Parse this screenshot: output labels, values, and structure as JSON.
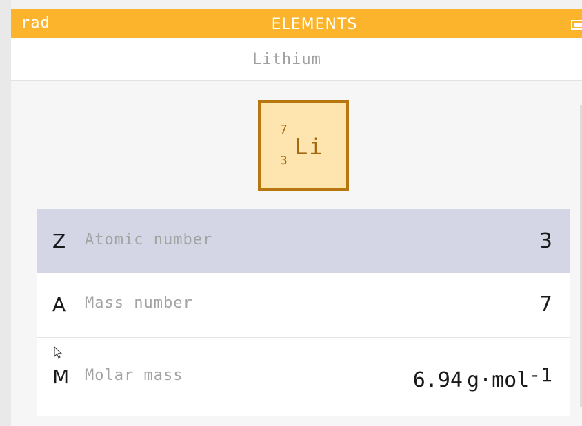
{
  "header": {
    "mode": "rad",
    "title": "ELEMENTS",
    "battery_icon": "battery-icon"
  },
  "subtitle": "Lithium",
  "element": {
    "mass_number": "7",
    "atomic_number": "3",
    "symbol": "Li"
  },
  "properties": [
    {
      "symbol": "Z",
      "label": "Atomic number",
      "value": "3",
      "selected": true
    },
    {
      "symbol": "A",
      "label": "Mass number",
      "value": "7",
      "selected": false
    },
    {
      "symbol": "M",
      "label": "Molar mass",
      "value": "6.94",
      "unit": "g·mol",
      "exponent": "-1",
      "selected": false
    }
  ],
  "colors": {
    "header": "#fbb42c",
    "tile_border": "#b8760e",
    "tile_fill": "#fee5b0",
    "selected_row": "#d5d6e5"
  },
  "icons": [
    "battery-icon",
    "mouse-pointer-icon"
  ]
}
